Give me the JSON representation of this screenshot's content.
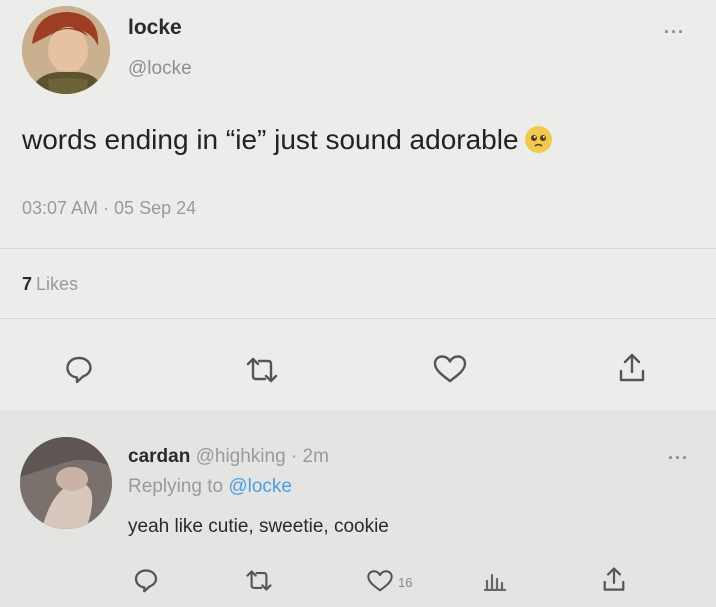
{
  "tweet": {
    "name": "locke",
    "handle": "@locke",
    "text": "words ending in “ie” just sound adorable",
    "emoji": "pleading-face-emoji",
    "timestamp": "03:07 AM · 05 Sep 24",
    "likes_count": "7",
    "likes_label": "Likes",
    "more": "···"
  },
  "reply": {
    "name": "cardan",
    "handle": "@highking",
    "time": "· 2m",
    "replying_prefix": "Replying to",
    "replying_mention": "@locke",
    "text": "yeah like cutie, sweetie, cookie",
    "like_count": "16",
    "more": "···"
  },
  "colors": {
    "background": "#ececea",
    "text": "#222222",
    "muted": "#9a9a9a",
    "link": "#4a9fe6"
  }
}
